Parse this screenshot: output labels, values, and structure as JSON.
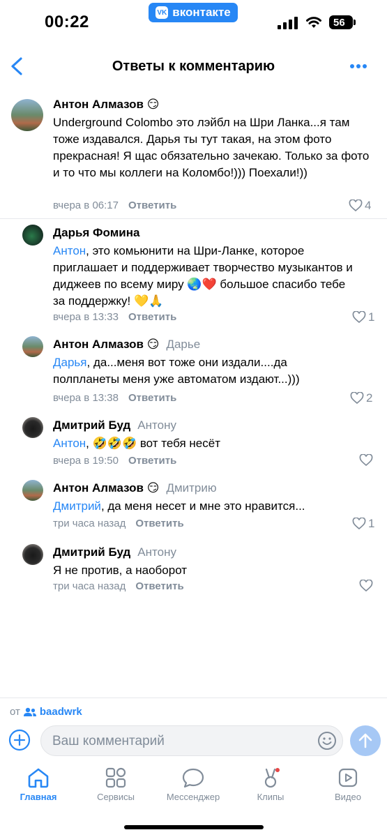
{
  "status_bar": {
    "time": "00:22",
    "app_badge": "вконтакте",
    "app_badge_logo": "VK",
    "battery": "56"
  },
  "header": {
    "title": "Ответы к комментарию"
  },
  "comments": [
    {
      "author": "Антон Алмазов",
      "emoji": "😏",
      "to": "",
      "mention": "",
      "text": "Underground Colombo это лэйбл на Шри Ланка...я там тоже издавался. Дарья ты тут такая, на этом фото прекрасная! Я щас обязательно зачекаю. Только за фото и то что мы коллеги на Коломбо!))) Поехали!))",
      "time": "вчера в 06:17",
      "reply": "Ответить",
      "likes": "4"
    },
    {
      "author": "Дарья Фомина",
      "emoji": "",
      "to": "",
      "mention": "Антон",
      "text": ", это комьюнити на Шри-Ланке, которое приглашает и поддерживает творчество музыкантов и диджеев по всему миру 🌏❤️ большое спасибо тебе за поддержку! 💛🙏",
      "time": "вчера в 13:33",
      "reply": "Ответить",
      "likes": "1"
    },
    {
      "author": "Антон Алмазов",
      "emoji": "😏",
      "to": "Дарье",
      "mention": "Дарья",
      "text": ", да...меня вот тоже они издали....да полпланеты меня уже автоматом издают...)))",
      "time": "вчера в 13:38",
      "reply": "Ответить",
      "likes": "2"
    },
    {
      "author": "Дмитрий Буд",
      "emoji": "",
      "to": "Антону",
      "mention": "Антон",
      "text": ", 🤣🤣🤣 вот тебя несёт",
      "time": "вчера в 19:50",
      "reply": "Ответить",
      "likes": ""
    },
    {
      "author": "Антон Алмазов",
      "emoji": "😏",
      "to": "Дмитрию",
      "mention": "Дмитрий",
      "text": ", да меня несет и мне это нравится...",
      "time": "три часа назад",
      "reply": "Ответить",
      "likes": "1"
    },
    {
      "author": "Дмитрий Буд",
      "emoji": "",
      "to": "Антону",
      "mention": "",
      "text": "Я не против, а наоборот",
      "time": "три часа назад",
      "reply": "Ответить",
      "likes": ""
    }
  ],
  "composer": {
    "from_label": "от",
    "group_name": "baadwrk",
    "placeholder": "Ваш комментарий"
  },
  "tabbar": [
    {
      "label": "Главная"
    },
    {
      "label": "Сервисы"
    },
    {
      "label": "Мессенджер"
    },
    {
      "label": "Клипы"
    },
    {
      "label": "Видео"
    }
  ],
  "colors": {
    "accent": "#2787f5",
    "secondary_text": "#818c99",
    "send_disabled": "#a6c8f5"
  }
}
